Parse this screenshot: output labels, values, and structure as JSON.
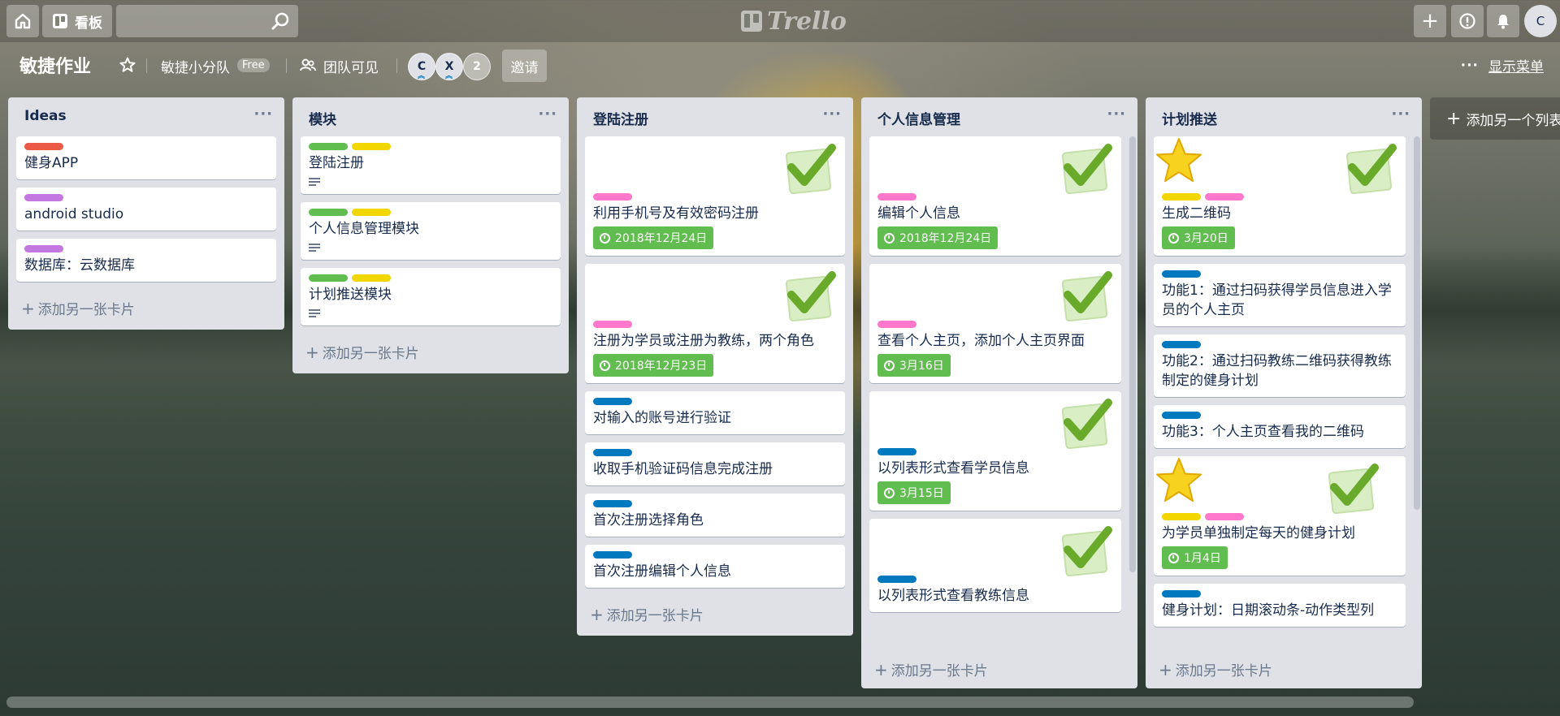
{
  "topbar": {
    "boards_label": "看板",
    "search_placeholder": "",
    "logo_text": "Trello",
    "avatar_initial": "C"
  },
  "board": {
    "title": "敏捷作业",
    "team": "敏捷小分队",
    "team_badge": "Free",
    "visibility": "团队可见",
    "members": [
      {
        "initial": "C"
      },
      {
        "initial": "X"
      }
    ],
    "member_count": "2",
    "invite_label": "邀请",
    "show_menu_label": "显示菜单"
  },
  "lists": [
    {
      "title": "Ideas",
      "add_card": "添加另一张卡片",
      "cards": [
        {
          "labels": [
            "red"
          ],
          "title": "健身APP"
        },
        {
          "labels": [
            "purple"
          ],
          "title": "android studio"
        },
        {
          "labels": [
            "purple"
          ],
          "title": "数据库：云数据库"
        }
      ]
    },
    {
      "title": "模块",
      "add_card": "添加另一张卡片",
      "cards": [
        {
          "labels": [
            "green",
            "yellow"
          ],
          "title": "登陆注册",
          "has_description": true
        },
        {
          "labels": [
            "green",
            "yellow"
          ],
          "title": "个人信息管理模块",
          "has_description": true
        },
        {
          "labels": [
            "green",
            "yellow"
          ],
          "title": "计划推送模块",
          "has_description": true
        }
      ]
    },
    {
      "title": "登陆注册",
      "add_card": "添加另一张卡片",
      "cards": [
        {
          "stickers": [
            "check"
          ],
          "labels": [
            "pink"
          ],
          "title": "利用手机号及有效密码注册",
          "due": "2018年12月24日"
        },
        {
          "stickers": [
            "check"
          ],
          "labels": [
            "pink"
          ],
          "title": "注册为学员或注册为教练，两个角色",
          "due": "2018年12月23日"
        },
        {
          "labels": [
            "blue"
          ],
          "title": "对输入的账号进行验证"
        },
        {
          "labels": [
            "blue"
          ],
          "title": "收取手机验证码信息完成注册"
        },
        {
          "labels": [
            "blue"
          ],
          "title": "首次注册选择角色"
        },
        {
          "labels": [
            "blue"
          ],
          "title": "首次注册编辑个人信息"
        }
      ]
    },
    {
      "title": "个人信息管理",
      "add_card": "添加另一张卡片",
      "cards": [
        {
          "stickers": [
            "check"
          ],
          "labels": [
            "pink"
          ],
          "title": "编辑个人信息",
          "due": "2018年12月24日"
        },
        {
          "stickers": [
            "check"
          ],
          "labels": [
            "pink"
          ],
          "title": "查看个人主页，添加个人主页界面",
          "due": "3月16日"
        },
        {
          "stickers": [
            "check"
          ],
          "labels": [
            "blue"
          ],
          "title": "以列表形式查看学员信息",
          "due": "3月15日"
        },
        {
          "stickers": [
            "check"
          ],
          "labels": [
            "blue"
          ],
          "title": "以列表形式查看教练信息"
        }
      ]
    },
    {
      "title": "计划推送",
      "add_card": "添加另一张卡片",
      "cards": [
        {
          "stickers": [
            "star",
            "check"
          ],
          "labels": [
            "yellow",
            "pink"
          ],
          "title": "生成二维码",
          "due": "3月20日"
        },
        {
          "labels": [
            "blue"
          ],
          "title": "功能1：通过扫码获得学员信息进入学员的个人主页"
        },
        {
          "labels": [
            "blue"
          ],
          "title": "功能2：通过扫码教练二维码获得教练制定的健身计划"
        },
        {
          "labels": [
            "blue"
          ],
          "title": "功能3：个人主页查看我的二维码"
        },
        {
          "stickers": [
            "star",
            "check"
          ],
          "labels": [
            "yellow",
            "pink"
          ],
          "title": "为学员单独制定每天的健身计划",
          "due": "1月4日"
        },
        {
          "labels": [
            "blue"
          ],
          "title": "健身计划：日期滚动条-动作类型列"
        }
      ]
    }
  ],
  "add_list_label": "添加另一个列表"
}
